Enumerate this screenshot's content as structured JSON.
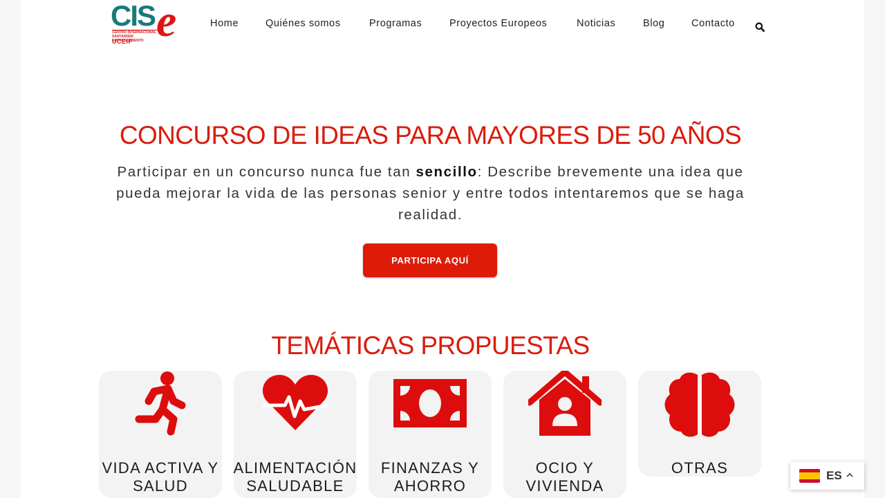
{
  "logo": {
    "main": "CIS",
    "accent": "e",
    "tagline_1": "CENTRO INTERNACIONAL",
    "tagline_2": "SANTANDER EMPRENDIMIENTO",
    "sub": "UCEIF"
  },
  "nav": {
    "items": [
      "Home",
      "Quiénes somos",
      "Programas",
      "Proyectos Europeos",
      "Noticias",
      "Blog",
      "Contacto"
    ],
    "search_icon": "search-icon"
  },
  "hero": {
    "title": "CONCURSO DE IDEAS PARA MAYORES DE 50 AÑOS",
    "desc_before": "Participar en un concurso nunca fue tan ",
    "desc_bold": "sencillo",
    "desc_after": ": Describe brevemente una idea que pueda mejorar la vida de las personas senior y entre todos intentaremos que se haga realidad.",
    "cta_label": "PARTICIPA AQUÍ"
  },
  "topics": {
    "title": "TEMÁTICAS PROPUESTAS",
    "items": [
      {
        "label": "VIDA ACTIVA Y SALUD",
        "icon": "running-person-icon"
      },
      {
        "label": "ALIMENTACIÓN SALUDABLE",
        "icon": "heartbeat-icon"
      },
      {
        "label": "FINANZAS Y AHORRO",
        "icon": "money-bill-icon"
      },
      {
        "label": "OCIO Y VIVIENDA",
        "icon": "house-user-icon"
      },
      {
        "label": "OTRAS",
        "icon": "brain-icon"
      }
    ]
  },
  "language": {
    "code": "ES",
    "flag": "spain-flag-icon"
  },
  "colors": {
    "accent": "#dd1b06",
    "brand_teal": "#1a7a7a",
    "card_bg": "#f3f3f3"
  }
}
